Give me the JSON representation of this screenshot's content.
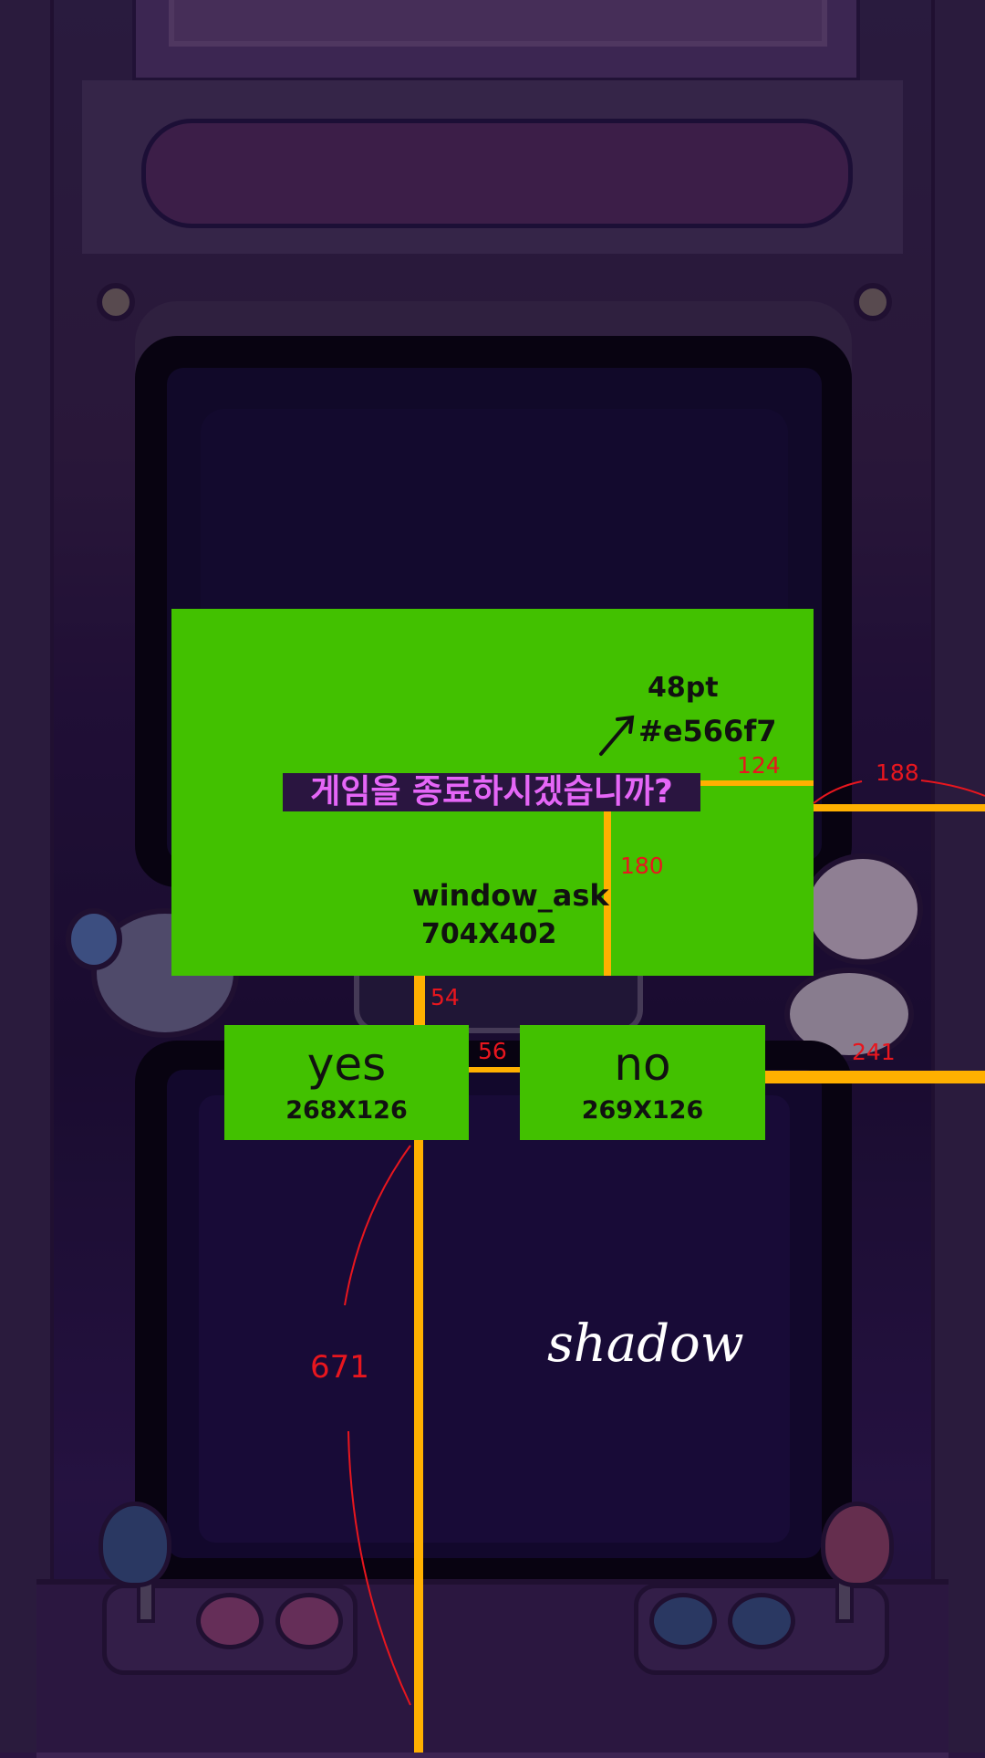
{
  "dialog": {
    "message": "게임을 종료하시겠습니까?",
    "text_style_note": {
      "size": "48pt",
      "color": "#e566f7"
    },
    "window": {
      "name": "window_ask",
      "size": "704X402"
    },
    "buttons": {
      "yes": {
        "label": "yes",
        "size": "268X126"
      },
      "no": {
        "label": "no",
        "size": "269X126"
      }
    }
  },
  "spec_annotations": {
    "dims": [
      "124",
      "188",
      "180",
      "54",
      "56",
      "241",
      "671"
    ],
    "overlay_label": "shadow"
  },
  "colors": {
    "spec_fill": "#42c100",
    "guide_line": "#ffb000",
    "annotation_red": "#e8161e",
    "text_accent": "#e566f7"
  }
}
